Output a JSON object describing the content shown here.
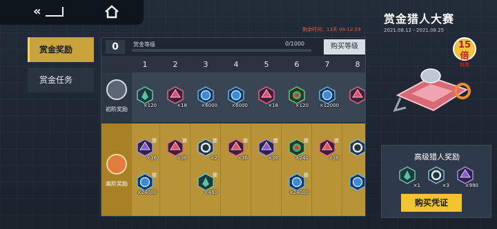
{
  "nav": {
    "back_label": "«",
    "home_icon": "home-icon"
  },
  "side_menu": [
    {
      "label": "赏金奖励",
      "active": true
    },
    {
      "label": "赏金任务",
      "active": false
    }
  ],
  "timer": "剩余时间：13天 04:12:29",
  "level": {
    "value": "0",
    "label": "赏金等级",
    "progress_text": "0/1000",
    "progress_fraction": 0,
    "buy_label": "购买等级"
  },
  "columns": [
    "1",
    "2",
    "3",
    "4",
    "5",
    "6",
    "7",
    "8"
  ],
  "rows": {
    "basic": {
      "label": "初阶奖励",
      "items": [
        {
          "icon": "green-crystal-icon",
          "qty": "×120"
        },
        {
          "icon": "pink-crystal-icon",
          "qty": "×18"
        },
        {
          "icon": "blue-coin-icon",
          "qty": "×6000"
        },
        {
          "icon": "blue-coin-icon",
          "qty": "×6000"
        },
        {
          "icon": "pink-crystal-icon",
          "qty": "×18"
        },
        {
          "icon": "green-flower-icon",
          "qty": "×120"
        },
        {
          "icon": "blue-coin-icon",
          "qty": "×12000"
        },
        {
          "icon": "pink-crystal-icon",
          "qty": ""
        }
      ]
    },
    "advanced": {
      "label": "高阶奖励",
      "lock_label": "锁",
      "items_top": [
        {
          "icon": "purple-crystal-icon",
          "qty": "×36"
        },
        {
          "icon": "pink-crystal-icon",
          "qty": "×36"
        },
        {
          "icon": "ring-icon",
          "qty": "×2"
        },
        {
          "icon": "pink-crystal-icon",
          "qty": "×36"
        },
        {
          "icon": "purple-crystal-icon",
          "qty": "×36"
        },
        {
          "icon": "green-flower-icon",
          "qty": "×240"
        },
        {
          "icon": "pink-crystal-icon",
          "qty": "×36"
        },
        {
          "icon": "ring-icon",
          "qty": ""
        }
      ],
      "items_bottom": [
        {
          "icon": "blue-coin-icon",
          "qty": "×24000",
          "col": 0
        },
        {
          "icon": "green-crystal-icon",
          "qty": "×480",
          "col": 2
        },
        {
          "icon": "blue-coin-icon",
          "qty": "×24000",
          "col": 5
        },
        {
          "icon": "blue-coin-icon",
          "qty": "",
          "col": 7
        }
      ]
    }
  },
  "event": {
    "title": "赏金猎人大赛",
    "dates": "2021.08.12 - 2021.08.25",
    "multiplier_big": "15倍",
    "multiplier_small": "特惠"
  },
  "rewards": {
    "title": "高级猎人奖励",
    "items": [
      {
        "icon": "green-crystal-icon",
        "qty": "×1"
      },
      {
        "icon": "ring-icon",
        "qty": "×3"
      },
      {
        "icon": "purple-crystal-icon",
        "qty": "×990"
      }
    ],
    "buy_label": "购买凭证"
  },
  "colors": {
    "gold": "#c8a23a",
    "red_timer": "#e45a4a",
    "pink": "#e0506a",
    "purple": "#8a5ad0",
    "blue": "#3a8ad8",
    "green": "#4caa60"
  }
}
